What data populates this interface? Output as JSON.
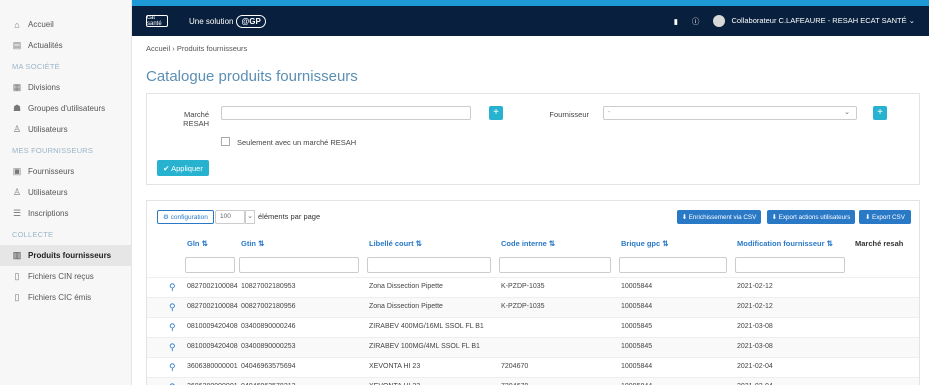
{
  "sidebar": {
    "items": [
      {
        "label": "Accueil",
        "icon": "home-icon",
        "glyph": "⌂"
      },
      {
        "label": "Actualités",
        "icon": "news-icon",
        "glyph": "▤"
      },
      {
        "section": "MA SOCIÉTÉ"
      },
      {
        "label": "Divisions",
        "icon": "grid-icon",
        "glyph": "▦"
      },
      {
        "label": "Groupes d'utilisateurs",
        "icon": "users-group-icon",
        "glyph": "☗"
      },
      {
        "label": "Utilisateurs",
        "icon": "user-icon",
        "glyph": "♙"
      },
      {
        "section": "MES FOURNISSEURS"
      },
      {
        "label": "Fournisseurs",
        "icon": "building-icon",
        "glyph": "▣"
      },
      {
        "label": "Utilisateurs",
        "icon": "user-icon",
        "glyph": "♙"
      },
      {
        "label": "Inscriptions",
        "icon": "list-icon",
        "glyph": "☰"
      },
      {
        "section": "COLLECTE"
      },
      {
        "label": "Produits fournisseurs",
        "icon": "box-icon",
        "glyph": "▥",
        "active": true
      },
      {
        "label": "Fichiers CIN reçus",
        "icon": "file-icon",
        "glyph": "▯"
      },
      {
        "label": "Fichiers CIC émis",
        "icon": "file-icon",
        "glyph": "▯"
      }
    ]
  },
  "topbar": {
    "logo_mark": "cat santé",
    "solution_text": "Une solution",
    "gp_badge": "@GP",
    "user_label": "Collaborateur C.LAFEAURE - RESAH ECAT SANTÉ ⌄"
  },
  "breadcrumb": "Accueil  ›  Produits fournisseurs",
  "page_title": "Catalogue produits fournisseurs",
  "filters": {
    "marche_label_1": "Marché",
    "marche_label_2": "RESAH",
    "fournisseur_label": "Fournisseur",
    "fournisseur_placeholder": "-",
    "checkbox_label": "Seulement avec un marché RESAH",
    "apply_label": "✔ Appliquer"
  },
  "table_toolbar": {
    "config_label": "⚙ configuration",
    "per_page_value": "100",
    "per_page_label": "éléments par page",
    "btn_csv": "⬇ Enrichissement via CSV",
    "btn_export_users": "⬇ Export actions utilisateurs",
    "btn_export_csv": "⬇ Export CSV"
  },
  "table": {
    "columns": [
      "Gln ⇅",
      "Gtin ⇅",
      "Libellé court ⇅",
      "Code interne ⇅",
      "Brique gpc ⇅",
      "Modification fournisseur ⇅",
      "Marché resah"
    ],
    "rows": [
      [
        "0827002100084",
        "10827002180953",
        "Zona Dissection Pipette",
        "K-PZDP-1035",
        "10005844",
        "2021-02-12",
        ""
      ],
      [
        "0827002100084",
        "00827002180956",
        "Zona Dissection Pipette",
        "K-PZDP-1035",
        "10005844",
        "2021-02-12",
        ""
      ],
      [
        "0810009420408",
        "03400890000246",
        "ZIRABEV 400MG/16ML SSOL FL B1",
        "",
        "10005845",
        "2021-03-08",
        ""
      ],
      [
        "0810009420408",
        "03400890000253",
        "ZIRABEV 100MG/4ML SSOL FL B1",
        "",
        "10005845",
        "2021-03-08",
        ""
      ],
      [
        "3606380000001",
        "04046963575694",
        "XEVONTA HI 23",
        "7204670",
        "10005844",
        "2021-02-04",
        ""
      ],
      [
        "3606380000001",
        "04046963578213",
        "XEVONTA HI 23",
        "7204670",
        "10005844",
        "2021-02-04",
        ""
      ]
    ]
  }
}
